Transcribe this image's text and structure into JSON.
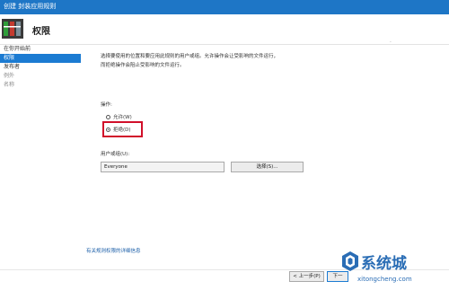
{
  "window": {
    "title": "创建 封装应用规则"
  },
  "header": {
    "heading": "权限"
  },
  "sidebar": {
    "items": [
      {
        "label": "在你开始前"
      },
      {
        "label": "权限"
      },
      {
        "label": "发布者"
      },
      {
        "label": "例外"
      },
      {
        "label": "名称"
      }
    ]
  },
  "main": {
    "description_line1": "选择要使用的位置和要应用此规则的用户或组。允许操作会让受影响的文件运行，",
    "description_line2": "而拒绝操作会阻止受影响的文件运行。",
    "dot_mark": "·",
    "action_label": "操作:",
    "radio_allow": "允许(W)",
    "radio_deny": "拒绝(D)",
    "selected_action": "拒绝(D)",
    "user_or_group_label": "用户或组(U):",
    "user_or_group_value": "Everyone",
    "select_button": "选择(S)...",
    "more_info_link": "有关规则权限的详细信息"
  },
  "footer": {
    "back_button": "< 上一步(P)",
    "next_button_partial": "下一"
  },
  "watermark": {
    "text_cn": "系统城",
    "url": "xitongcheng.com"
  },
  "colors": {
    "titlebar": "#1e76c6",
    "selection": "#1b7bd2",
    "highlight_box": "#d10f2a",
    "link": "#1b5ea8"
  }
}
